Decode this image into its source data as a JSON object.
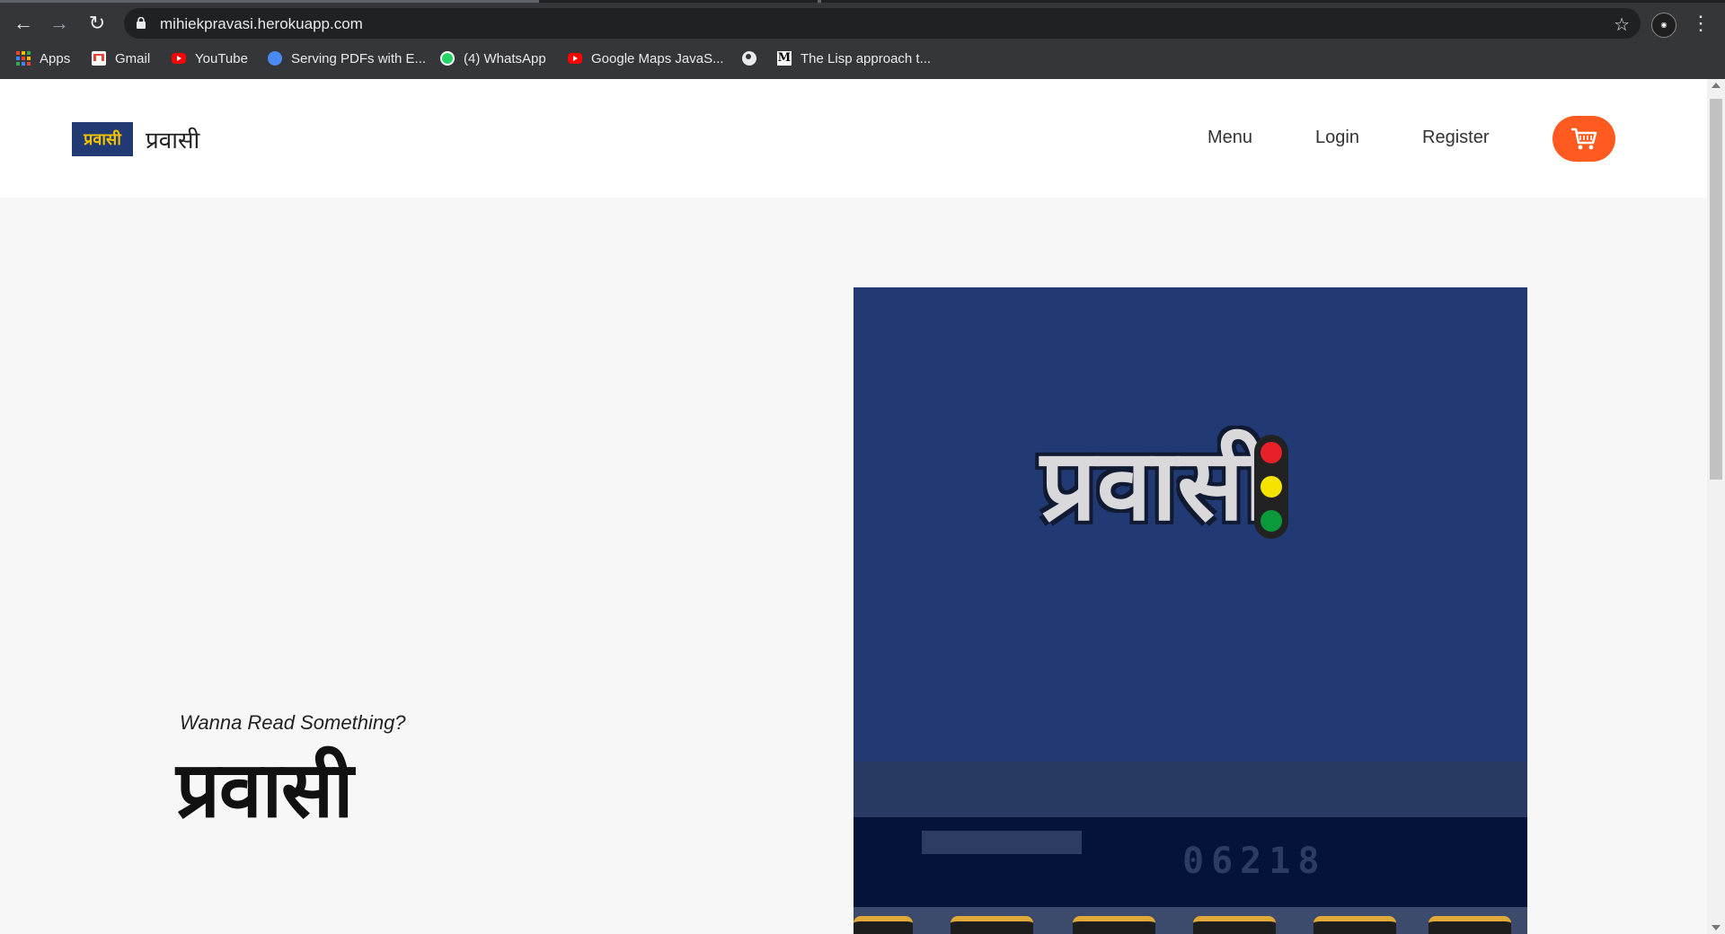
{
  "browser": {
    "url": "mihiekpravasi.herokuapp.com",
    "bookmarks": [
      {
        "label": "Apps",
        "icon": "apps-grid-icon"
      },
      {
        "label": "Gmail",
        "icon": "gmail-icon"
      },
      {
        "label": "YouTube",
        "icon": "youtube-icon"
      },
      {
        "label": "Serving PDFs with E...",
        "icon": "pdf-site-icon"
      },
      {
        "label": "(4) WhatsApp",
        "icon": "whatsapp-icon"
      },
      {
        "label": "Google Maps JavaS...",
        "icon": "youtube-icon"
      },
      {
        "label": "",
        "icon": "globe-icon"
      },
      {
        "label": "The Lisp approach t...",
        "icon": "medium-icon"
      }
    ]
  },
  "site": {
    "brand_badge": "प्रवासी",
    "brand_name": "प्रवासी",
    "nav": {
      "menu": "Menu",
      "login": "Login",
      "register": "Register"
    },
    "colors": {
      "accent": "#ff5a1f",
      "hero_bg": "#223a73"
    }
  },
  "hero": {
    "tagline": "Wanna Read Something?",
    "title": "प्रवासी",
    "image_logo_text": "प्रवासी",
    "bus_number": "06218"
  }
}
